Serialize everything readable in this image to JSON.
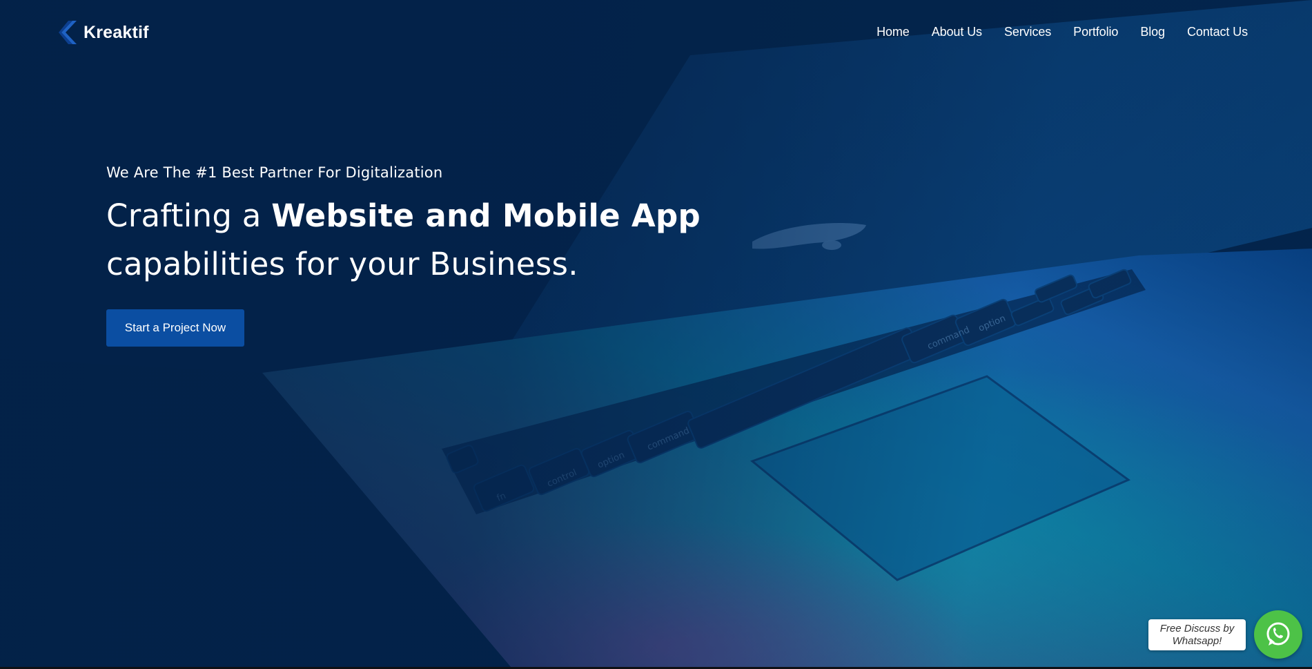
{
  "brand": {
    "name": "Kreaktif",
    "accent": "#0b4ea2",
    "background": "#04244a"
  },
  "nav": {
    "items": [
      {
        "label": "Home"
      },
      {
        "label": "About Us"
      },
      {
        "label": "Services"
      },
      {
        "label": "Portfolio"
      },
      {
        "label": "Blog"
      },
      {
        "label": "Contact Us"
      }
    ]
  },
  "hero": {
    "tagline": "We Are The #1 Best Partner For Digitalization",
    "headline_prefix": "Crafting a ",
    "headline_bold": "Website and Mobile App",
    "headline_suffix": "capabilities for your Business.",
    "cta_label": "Start a Project Now",
    "background_image": "laptop-keyboard-photo"
  },
  "keyboard_labels": {
    "fn": "fn",
    "control": "control",
    "option_left": "option",
    "command_left": "command",
    "command_right": "command",
    "option_right": "option"
  },
  "whatsapp": {
    "label": "Free Discuss by Whatsapp!",
    "icon": "whatsapp-icon",
    "color": "#4dc247"
  }
}
